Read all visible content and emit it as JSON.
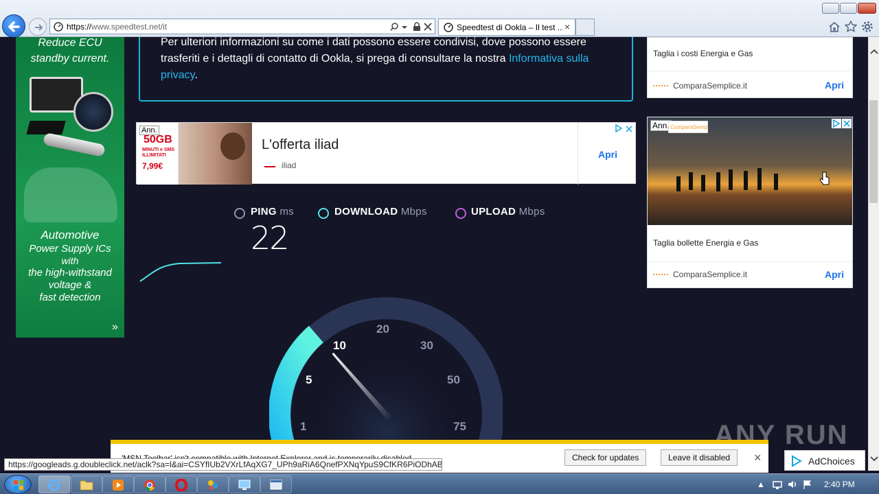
{
  "browser": {
    "url_prefix": "https://",
    "url_domain": "www.speedtest.net",
    "url_path": "/it",
    "tab_title": "Speedtest di Ookla – Il test ...",
    "tab_close": "×"
  },
  "privacy": {
    "text": "Per ulteriori informazioni su come i dati possono essere condivisi, dove possono essere trasferiti e i dettagli di contatto di Ookla, si prega di consultare la nostra",
    "link": "Informativa sulla privacy",
    "end": "."
  },
  "left_ad": {
    "line1": "Reduce ECU",
    "line2": "standby current.",
    "line3": "Automotive",
    "line4": "Power Supply ICs",
    "line5": "with",
    "line6": "the high-withstand",
    "line7": "voltage &",
    "line8": "fast detection",
    "arrow": "»"
  },
  "iliad_ad": {
    "badge": "Ann.",
    "promo": "50GB",
    "promo_sub": "MINUTI e SMS ILLIMITATI",
    "price": "7,99€",
    "headline": "L'offerta iliad",
    "brand": "iliad",
    "cta": "Apri"
  },
  "right_ad_top": {
    "title": "Taglia i costi Energia e Gas",
    "source": "ComparaSemplice.it",
    "cta": "Apri"
  },
  "right_ad_bottom": {
    "badge": "Ann.",
    "logo": "ComparaSemplice.it",
    "title": "Taglia bollette Energia e Gas",
    "source": "ComparaSemplice.it",
    "cta": "Apri"
  },
  "speedtest": {
    "ping_label": "PING",
    "ping_unit": "ms",
    "ping_value": "22",
    "download_label": "DOWNLOAD",
    "download_unit": "Mbps",
    "upload_label": "UPLOAD",
    "upload_unit": "Mbps",
    "gauge_labels": [
      "1",
      "5",
      "10",
      "20",
      "30",
      "50",
      "75"
    ],
    "gauge_progress": 10
  },
  "notification": {
    "message": "'MSN Toolbar' isn't compatible with Internet Explorer and is temporarily disabled.",
    "check_button": "Check for updates",
    "leave_button": "Leave it disabled",
    "close": "×"
  },
  "adchoices": "AdChoices",
  "status_url": "https://googleads.g.doubleclick.net/aclk?sa=l&ai=CSYfIUb2VXrLfAqXG7_UPh9aRiA6QnefPXNqYpuS9CfKR6PiODhABI...",
  "watermark": "ANY RUN",
  "clock": "2:40 PM",
  "colors": {
    "page_bg": "#141526",
    "accent_cyan": "#1fb5d9",
    "link_blue": "#1a73e8"
  }
}
